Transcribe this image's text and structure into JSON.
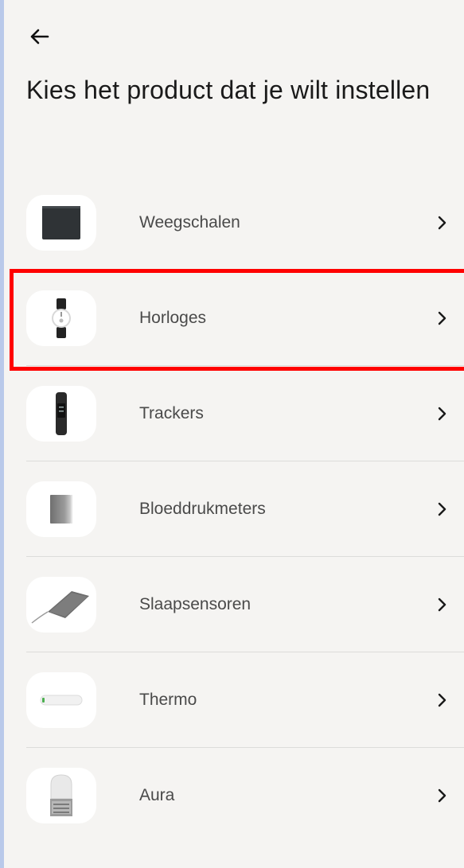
{
  "header": {
    "back_icon": "arrow-left-icon",
    "title": "Kies het product dat je wilt instellen"
  },
  "products": [
    {
      "label": "Weegschalen",
      "icon": "scale-icon"
    },
    {
      "label": "Horloges",
      "icon": "watch-icon"
    },
    {
      "label": "Trackers",
      "icon": "tracker-icon"
    },
    {
      "label": "Bloeddrukmeters",
      "icon": "blood-pressure-monitor-icon"
    },
    {
      "label": "Slaapsensoren",
      "icon": "sleep-sensor-icon"
    },
    {
      "label": "Thermo",
      "icon": "thermometer-icon"
    },
    {
      "label": "Aura",
      "icon": "aura-icon"
    }
  ],
  "colors": {
    "background": "#f5f4f2",
    "highlight": "#ff0000",
    "text": "#1a1a1a",
    "label": "#4a4a4a"
  }
}
